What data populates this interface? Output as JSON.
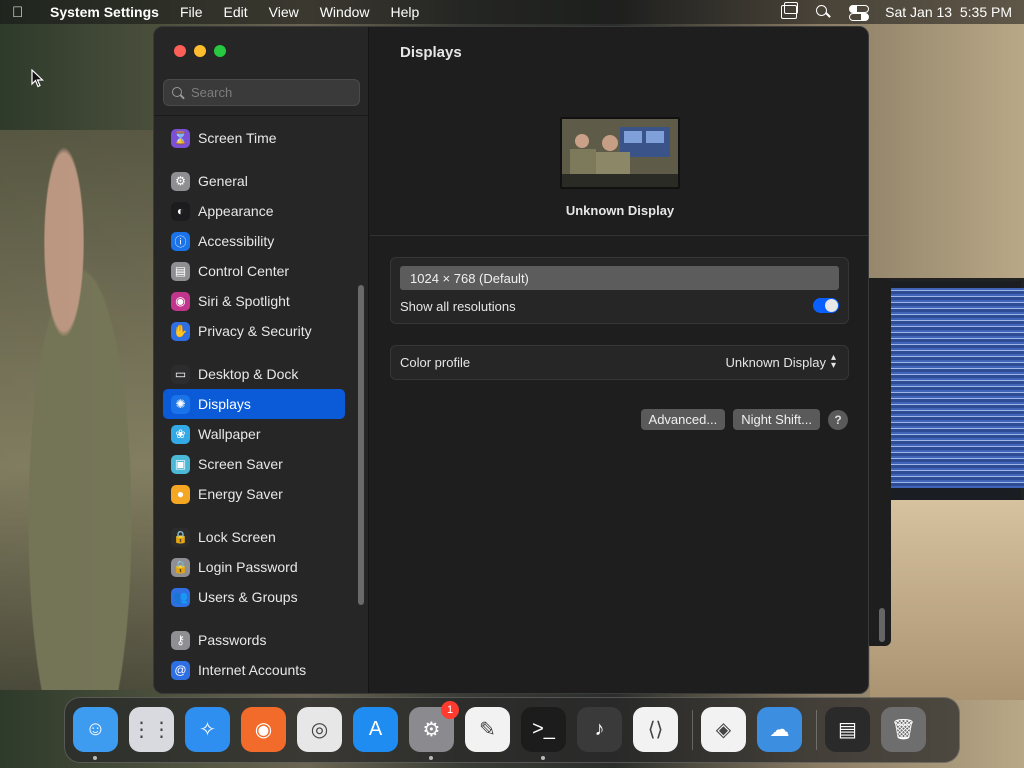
{
  "menubar": {
    "app_name": "System Settings",
    "menus": [
      "File",
      "Edit",
      "View",
      "Window",
      "Help"
    ],
    "clock": "Sat Jan 13  5:35 PM"
  },
  "window": {
    "title": "Displays",
    "search_placeholder": "Search"
  },
  "sidebar": {
    "items": [
      {
        "label": "Screen Time",
        "icon": "hourglass-icon",
        "color": "#7b4fd6",
        "glyph": "⌛"
      },
      {
        "label": "General",
        "icon": "gear-icon",
        "color": "#8e8e93",
        "glyph": "⚙"
      },
      {
        "label": "Appearance",
        "icon": "appearance-icon",
        "color": "#1c1c1e",
        "glyph": "◐"
      },
      {
        "label": "Accessibility",
        "icon": "accessibility-icon",
        "color": "#1a73e8",
        "glyph": "ⓘ"
      },
      {
        "label": "Control Center",
        "icon": "control-center-icon",
        "color": "#8e8e93",
        "glyph": "▤"
      },
      {
        "label": "Siri & Spotlight",
        "icon": "siri-icon",
        "color": "#c2358d",
        "glyph": "◉"
      },
      {
        "label": "Privacy & Security",
        "icon": "hand-icon",
        "color": "#2f6fe4",
        "glyph": "✋"
      },
      {
        "label": "Desktop & Dock",
        "icon": "dock-icon",
        "color": "#2c2c2e",
        "glyph": "▭"
      },
      {
        "label": "Displays",
        "icon": "sun-icon",
        "color": "#1a73e8",
        "glyph": "✺"
      },
      {
        "label": "Wallpaper",
        "icon": "flower-icon",
        "color": "#33a9e6",
        "glyph": "❀"
      },
      {
        "label": "Screen Saver",
        "icon": "screen-saver-icon",
        "color": "#4bb8d6",
        "glyph": "▣"
      },
      {
        "label": "Energy Saver",
        "icon": "lightbulb-icon",
        "color": "#f5a623",
        "glyph": "●"
      },
      {
        "label": "Lock Screen",
        "icon": "lock-icon",
        "color": "#2c2c2e",
        "glyph": "🔒"
      },
      {
        "label": "Login Password",
        "icon": "lock-icon",
        "color": "#8e8e93",
        "glyph": "🔒"
      },
      {
        "label": "Users & Groups",
        "icon": "users-icon",
        "color": "#2f6fe4",
        "glyph": "👥"
      },
      {
        "label": "Passwords",
        "icon": "key-icon",
        "color": "#8e8e93",
        "glyph": "⚷"
      },
      {
        "label": "Internet Accounts",
        "icon": "at-icon",
        "color": "#2f6fe4",
        "glyph": "@"
      }
    ],
    "selected_index": 8
  },
  "displays": {
    "display_name": "Unknown Display",
    "resolution": "1024 × 768 (Default)",
    "show_all_resolutions_label": "Show all resolutions",
    "show_all_resolutions_on": true,
    "color_profile_label": "Color profile",
    "color_profile_value": "Unknown Display",
    "advanced_button": "Advanced...",
    "night_shift_button": "Night Shift...",
    "help_button": "?"
  },
  "dock": {
    "apps": [
      {
        "name": "finder-icon",
        "color": "#3d9cf0",
        "glyph": "☺",
        "running": true
      },
      {
        "name": "launchpad-icon",
        "color": "#d9d9e0",
        "glyph": "⋮⋮",
        "running": false
      },
      {
        "name": "safari-icon",
        "color": "#2e8ff0",
        "glyph": "✧",
        "running": false
      },
      {
        "name": "firefox-icon",
        "color": "#f26b2a",
        "glyph": "◉",
        "running": false
      },
      {
        "name": "chrome-icon",
        "color": "#e7e7e7",
        "glyph": "◎",
        "running": false
      },
      {
        "name": "app-store-icon",
        "color": "#1f8cf2",
        "glyph": "A",
        "running": false
      },
      {
        "name": "system-settings-icon",
        "color": "#8a8a8f",
        "glyph": "⚙",
        "running": true,
        "badge": "1"
      },
      {
        "name": "textedit-icon",
        "color": "#f2f2f2",
        "glyph": "✎",
        "running": false
      },
      {
        "name": "terminal-icon",
        "color": "#1c1c1c",
        "glyph": ">_",
        "running": true
      },
      {
        "name": "garageband-icon",
        "color": "#3a3a3a",
        "glyph": "♪",
        "running": false
      },
      {
        "name": "vscode-icon",
        "color": "#f2f2f2",
        "glyph": "⟨⟩",
        "running": false
      },
      {
        "name": "visual-studio-icon",
        "color": "#f2f2f2",
        "glyph": "◈",
        "running": false
      },
      {
        "name": "weather-icon",
        "color": "#3c8fe0",
        "glyph": "☁",
        "running": false
      },
      {
        "name": "screen-thumbnail-icon",
        "color": "#2a2a2a",
        "glyph": "▤",
        "running": false
      },
      {
        "name": "trash-icon",
        "color": "#6e6e6e",
        "glyph": "🗑",
        "running": false
      }
    ]
  }
}
